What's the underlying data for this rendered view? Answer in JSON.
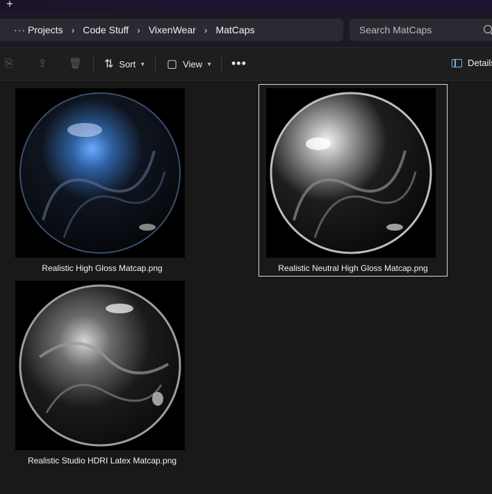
{
  "window": {
    "new_tab_icon": "plus-icon"
  },
  "breadcrumb": {
    "more_label": "···",
    "items": [
      "Projects",
      "Code Stuff",
      "VixenWear",
      "MatCaps"
    ]
  },
  "search": {
    "placeholder": "Search MatCaps"
  },
  "toolbar": {
    "sort_label": "Sort",
    "view_label": "View",
    "more_label": "•••",
    "details_label": "Details"
  },
  "files": [
    {
      "name": "Realistic High Gloss Matcap.png",
      "selected": false,
      "tint": "#4a86d8"
    },
    {
      "name": "Realistic Neutral High Gloss Matcap.png",
      "selected": true,
      "tint": "#c8c8c8"
    },
    {
      "name": "Realistic Studio HDRI Latex Matcap.png",
      "selected": false,
      "tint": "#bfbfbf"
    }
  ],
  "colors": {
    "accent": "#67b7ff",
    "background": "#191919"
  }
}
